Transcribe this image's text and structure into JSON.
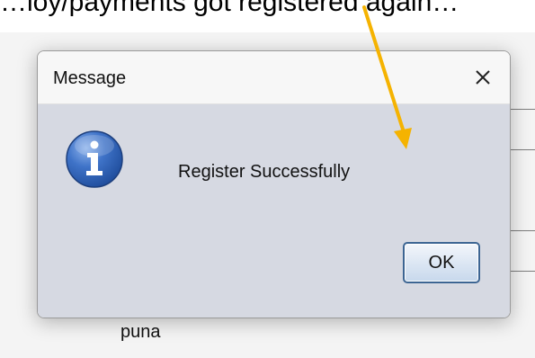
{
  "background": {
    "top_text": "…loy/payments got registered again…",
    "field_text": "puna"
  },
  "dialog": {
    "title": "Message",
    "close_label": "×",
    "icon": "information-icon",
    "message": "Register Successfully",
    "ok_label": "OK"
  },
  "colors": {
    "content_bg": "#d6d9e2",
    "title_bg": "#f7f7f7",
    "icon_blue": "#2f63b7",
    "button_border": "#3c6593",
    "annotation_arrow": "#f5b301"
  }
}
